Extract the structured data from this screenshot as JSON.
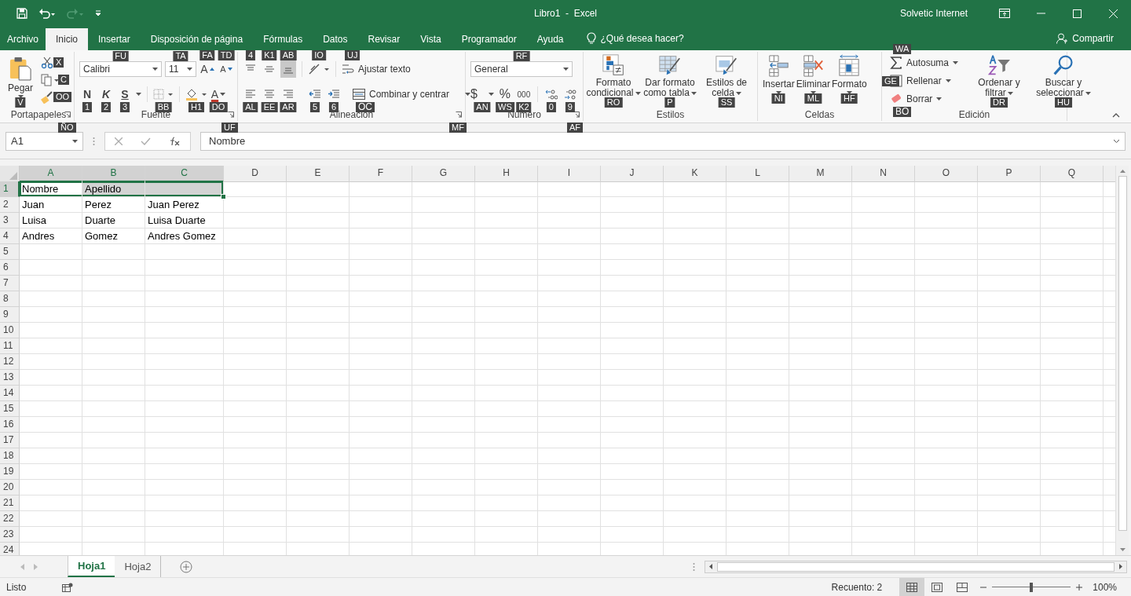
{
  "title_bar": {
    "title": "Libro1  -  Excel",
    "user": "Solvetic Internet"
  },
  "menu_tabs": [
    {
      "label": "Archivo",
      "selected": false
    },
    {
      "label": "Inicio",
      "selected": true
    },
    {
      "label": "Insertar",
      "selected": false
    },
    {
      "label": "Disposición de página",
      "selected": false
    },
    {
      "label": "Fórmulas",
      "selected": false
    },
    {
      "label": "Datos",
      "selected": false
    },
    {
      "label": "Revisar",
      "selected": false
    },
    {
      "label": "Vista",
      "selected": false
    },
    {
      "label": "Programador",
      "selected": false
    },
    {
      "label": "Ayuda",
      "selected": false
    }
  ],
  "tell_me": {
    "placeholder": "¿Qué desea hacer?"
  },
  "share": "Compartir",
  "ribbon": {
    "clipboard": {
      "label": "Portapapeles",
      "launcher_keytip": "ÑO",
      "paste": {
        "label": "Pegar",
        "keytip": "V"
      },
      "cut_keytip": "X",
      "copy_keytip": "C",
      "painter_keytip": "OO"
    },
    "font": {
      "label": "Fuente",
      "launcher_keytip": "UF",
      "font_name": {
        "value": "Calibri",
        "keytip": "FU"
      },
      "font_size": {
        "value": "11",
        "keytip": "TA"
      },
      "grow": {
        "label": "A",
        "keytip": "FA"
      },
      "shrink": {
        "label": "A",
        "keytip": "TD"
      },
      "bold": {
        "label": "N",
        "keytip": "1"
      },
      "italic": {
        "label": "K",
        "keytip": "2"
      },
      "underline": {
        "label": "S",
        "keytip": "3"
      },
      "borders_keytip": "BB",
      "fill_keytip": "H1",
      "font_color": {
        "label": "A",
        "keytip": "DO"
      }
    },
    "alignment": {
      "label": "Alineación",
      "launcher_keytip": "MF",
      "vertical": [
        {
          "kind": "top",
          "keytip": "4",
          "selected": false
        },
        {
          "kind": "middle",
          "keytip": "K1",
          "selected": false
        },
        {
          "kind": "bottom",
          "keytip": "AB",
          "selected": true
        }
      ],
      "orientation_keytip": "IO",
      "wrap": {
        "label": "Ajustar texto",
        "keytip": "UJ"
      },
      "horizontal": [
        {
          "kind": "left",
          "keytip": "AL",
          "selected": false
        },
        {
          "kind": "center",
          "keytip": "EE",
          "selected": false
        },
        {
          "kind": "right",
          "keytip": "AR",
          "selected": false
        }
      ],
      "outdent_keytip": "5",
      "indent_keytip": "6",
      "merge": {
        "label": "Combinar y centrar",
        "keytip": "OC"
      }
    },
    "number": {
      "label": "Número",
      "launcher_keytip": "AF",
      "format": {
        "value": "General",
        "keytip": "RF"
      },
      "currency": {
        "label": "$",
        "keytip": "AN"
      },
      "percent": {
        "label": "%",
        "keytip": "WS"
      },
      "thousands": {
        "label": "000",
        "keytip": "K2"
      },
      "increase_decimal_keytip": "0",
      "decrease_decimal_keytip": "9"
    },
    "styles": {
      "label": "Estilos",
      "buttons": [
        {
          "kind": "conditional",
          "label": "Formato condicional",
          "keytip": "RO"
        },
        {
          "kind": "table",
          "label": "Dar formato como tabla",
          "keytip": "P"
        },
        {
          "kind": "cell",
          "label": "Estilos de celda",
          "keytip": "SS"
        }
      ]
    },
    "cells": {
      "label": "Celdas",
      "buttons": [
        {
          "kind": "insert",
          "label": "Insertar",
          "keytip": "NI"
        },
        {
          "kind": "delete",
          "label": "Eliminar",
          "keytip": "ML"
        },
        {
          "kind": "format",
          "label": "Formato",
          "keytip": "HF"
        }
      ]
    },
    "editing": {
      "label": "Edición",
      "small": [
        {
          "kind": "autosum",
          "label": "Autosuma",
          "keytip": "WA"
        },
        {
          "kind": "fill",
          "label": "Rellenar",
          "keytip": "GE"
        },
        {
          "kind": "clear",
          "label": "Borrar",
          "keytip": "BO"
        }
      ],
      "buttons": [
        {
          "kind": "sort",
          "label": "Ordenar y filtrar",
          "keytip": "DR"
        },
        {
          "kind": "find",
          "label": "Buscar y seleccionar",
          "keytip": "HU"
        }
      ]
    }
  },
  "formula_bar": {
    "name_box": "A1",
    "value": "Nombre"
  },
  "columns": [
    "A",
    "B",
    "C",
    "D",
    "E",
    "F",
    "G",
    "H",
    "I",
    "J",
    "K",
    "L",
    "M",
    "N",
    "O",
    "P",
    "Q"
  ],
  "rows": [
    {
      "header": "1",
      "cells": [
        {
          "text": "Nombre",
          "selected": true,
          "active": true
        },
        {
          "text": "Apellido",
          "selected": true,
          "active": false
        },
        {
          "selected": true,
          "active": false
        }
      ]
    },
    {
      "header": "2",
      "cells": [
        {
          "text": "Juan",
          "selected": false,
          "active": false
        },
        {
          "text": "Perez",
          "selected": false,
          "active": false
        },
        {
          "text": "Juan Perez",
          "selected": false,
          "active": false
        }
      ]
    },
    {
      "header": "3",
      "cells": [
        {
          "text": "Luisa",
          "selected": false,
          "active": false
        },
        {
          "text": "Duarte",
          "selected": false,
          "active": false
        },
        {
          "text": "Luisa  Duarte",
          "selected": false,
          "active": false
        }
      ]
    },
    {
      "header": "4",
      "cells": [
        {
          "text": "Andres",
          "selected": false,
          "active": false
        },
        {
          "text": "Gomez",
          "selected": false,
          "active": false
        },
        {
          "text": "Andres  Gomez",
          "selected": false,
          "active": false
        }
      ]
    },
    {
      "header": "5"
    },
    {
      "header": "6"
    },
    {
      "header": "7"
    },
    {
      "header": "8"
    },
    {
      "header": "9"
    },
    {
      "header": "10"
    },
    {
      "header": "11"
    },
    {
      "header": "12"
    },
    {
      "header": "13"
    },
    {
      "header": "14"
    },
    {
      "header": "15"
    },
    {
      "header": "16"
    },
    {
      "header": "17"
    },
    {
      "header": "18"
    },
    {
      "header": "19"
    },
    {
      "header": "20"
    },
    {
      "header": "21"
    },
    {
      "header": "22"
    },
    {
      "header": "23"
    },
    {
      "header": "24"
    }
  ],
  "sheets": [
    {
      "label": "Hoja1",
      "selected": true
    },
    {
      "label": "Hoja2",
      "selected": false
    }
  ],
  "status_bar": {
    "status": "Listo",
    "count": "Recuento: 2",
    "views": [
      {
        "kind": "normal",
        "selected": true
      },
      {
        "kind": "page_layout",
        "selected": false
      },
      {
        "kind": "page_break",
        "selected": false
      }
    ],
    "zoom": {
      "level": 0.5,
      "reading": "100%"
    }
  }
}
